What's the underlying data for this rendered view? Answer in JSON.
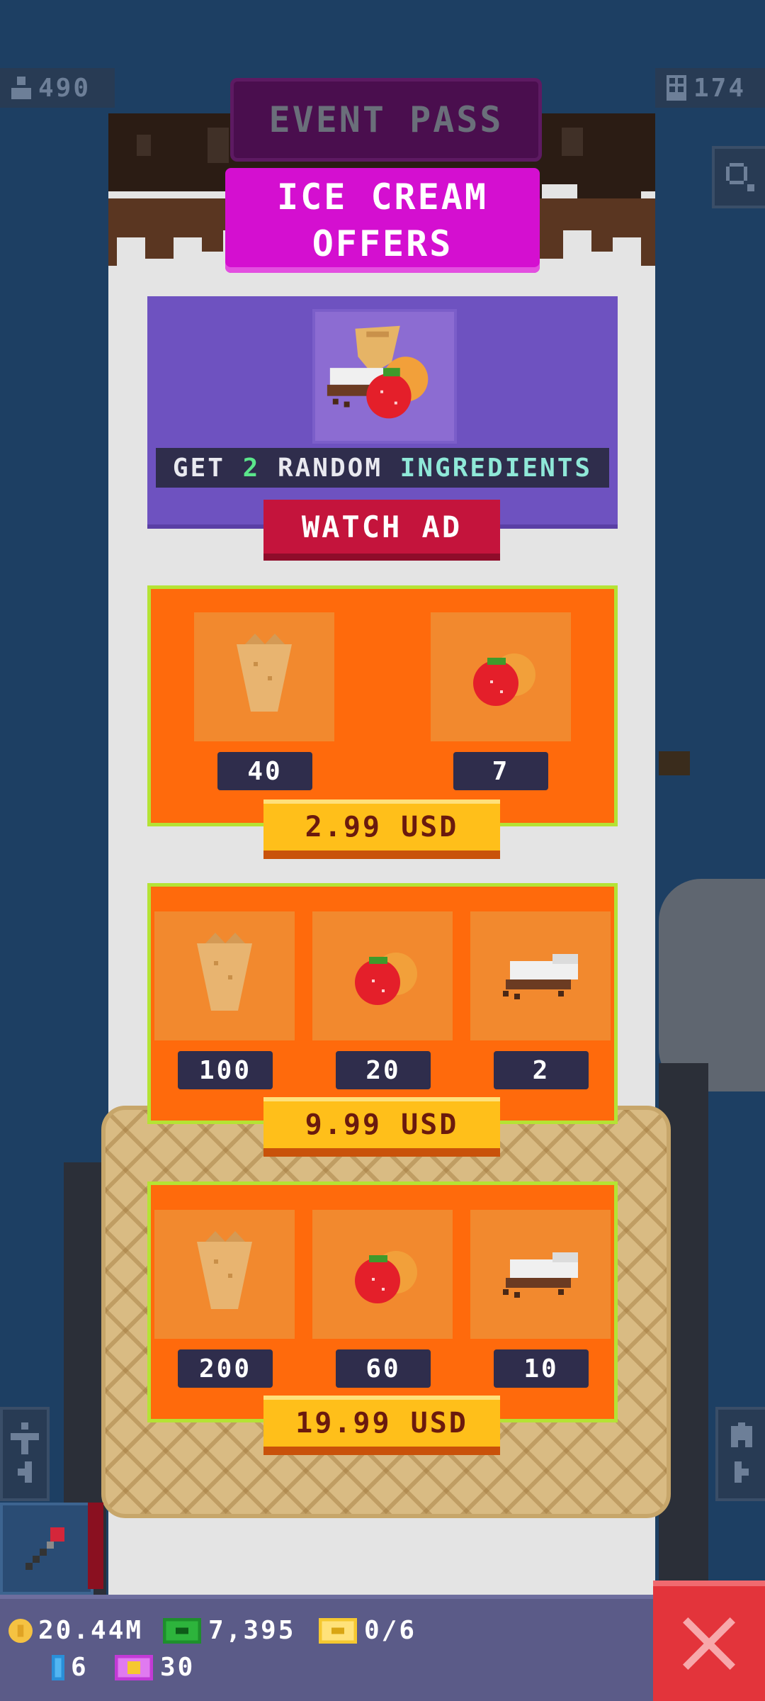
{
  "top_stats": {
    "population": "490",
    "floors": "174"
  },
  "modal": {
    "tab_label": "EVENT PASS",
    "title_line1": "ICE CREAM",
    "title_line2": "OFFERS"
  },
  "ad_offer": {
    "text_get": "GET ",
    "text_count": "2",
    "text_random": " RANDOM ",
    "text_ingredients": "INGREDIENTS",
    "button_label": "WATCH AD"
  },
  "offers": [
    {
      "counts": [
        "40",
        "7"
      ],
      "price": "2.99 USD"
    },
    {
      "counts": [
        "100",
        "20",
        "2"
      ],
      "price": "9.99 USD"
    },
    {
      "counts": [
        "200",
        "60",
        "10"
      ],
      "price": "19.99 USD"
    }
  ],
  "bottom_bar": {
    "coins": "20.44M",
    "bux": "7,395",
    "tickets": "0/6",
    "keys": "6",
    "vip": "30"
  },
  "icons": [
    "person-icon",
    "building-icon",
    "search-icon",
    "cone-icon",
    "fruit-icon",
    "chocolate-icon",
    "hammer-icon",
    "elevator-icon",
    "home-icon",
    "close-icon",
    "coin-icon",
    "bux-icon",
    "ticket-icon",
    "key-icon",
    "vip-icon"
  ],
  "colors": {
    "modal_title": "#d40fd0",
    "offer_bg": "#ff6a0c",
    "offer_border": "#b5e334",
    "watch_ad": "#c4143c",
    "price_button": "#ffbf1a",
    "close_button": "#e3343b"
  }
}
